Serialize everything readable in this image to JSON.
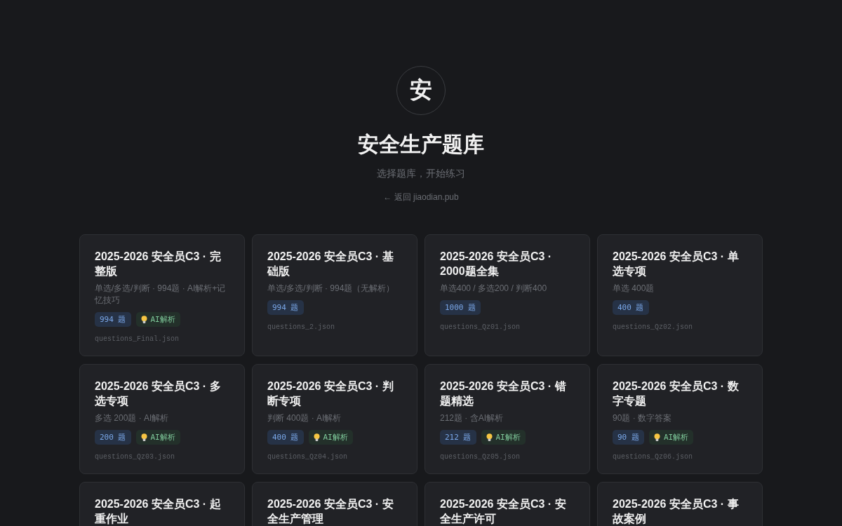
{
  "header": {
    "logo": "安",
    "title": "安全生产题库",
    "subtitle": "选择题库，开始练习",
    "back_link": "← 返回 jiaodian.pub"
  },
  "cards": [
    {
      "title": "2025-2026 安全员C3 · 完整版",
      "description": "单选/多选/判断 · 994题 · AI解析+记忆技巧",
      "count": "994 题",
      "ai_badge": "AI解析",
      "file": "questions_Final.json"
    },
    {
      "title": "2025-2026 安全员C3 · 基础版",
      "description": "单选/多选/判断 · 994题（无解析）",
      "count": "994 题",
      "file": "questions_2.json"
    },
    {
      "title": "2025-2026 安全员C3 · 2000题全集",
      "description": "单选400 / 多选200 / 判断400",
      "count": "1000 题",
      "file": "questions_Qz01.json"
    },
    {
      "title": "2025-2026 安全员C3 · 单选专项",
      "description": "单选 400题",
      "count": "400 题",
      "file": "questions_Qz02.json"
    },
    {
      "title": "2025-2026 安全员C3 · 多选专项",
      "description": "多选 200题 · AI解析",
      "count": "200 题",
      "ai_badge": "AI解析",
      "file": "questions_Qz03.json"
    },
    {
      "title": "2025-2026 安全员C3 · 判断专项",
      "description": "判断 400题 · AI解析",
      "count": "400 题",
      "ai_badge": "AI解析",
      "file": "questions_Qz04.json"
    },
    {
      "title": "2025-2026 安全员C3 · 错题精选",
      "description": "212题 · 含AI解析",
      "count": "212 题",
      "ai_badge": "AI解析",
      "file": "questions_Qz05.json"
    },
    {
      "title": "2025-2026 安全员C3 · 数字专题",
      "description": "90题 · 数字答案",
      "count": "90 题",
      "ai_badge": "AI解析",
      "file": "questions_Qz06.json"
    },
    {
      "title": "2025-2026 安全员C3 · 起重作业"
    },
    {
      "title": "2025-2026 安全员C3 · 安全生产管理"
    },
    {
      "title": "2025-2026 安全员C3 · 安全生产许可"
    },
    {
      "title": "2025-2026 安全员C3 · 事故案例"
    }
  ]
}
